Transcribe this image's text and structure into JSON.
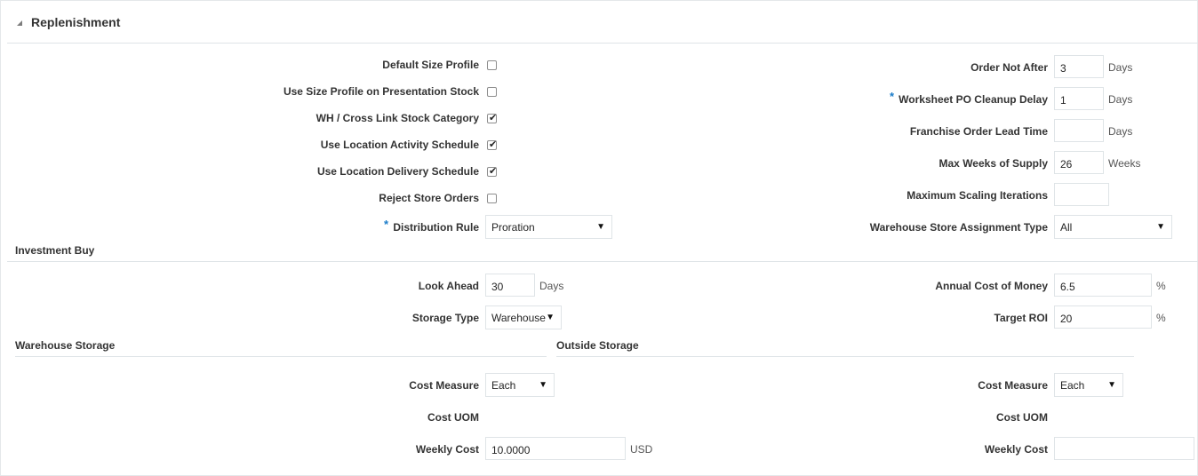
{
  "header": {
    "title": "Replenishment"
  },
  "left": {
    "default_size_profile": {
      "label": "Default Size Profile",
      "checked": false
    },
    "use_size_profile": {
      "label": "Use Size Profile on Presentation Stock",
      "checked": false
    },
    "wh_cross_link": {
      "label": "WH / Cross Link Stock Category",
      "checked": true
    },
    "use_activity_schedule": {
      "label": "Use Location Activity Schedule",
      "checked": true
    },
    "use_delivery_schedule": {
      "label": "Use Location Delivery Schedule",
      "checked": true
    },
    "reject_store_orders": {
      "label": "Reject Store Orders",
      "checked": false
    },
    "distribution_rule": {
      "label": "Distribution Rule",
      "value": "Proration"
    }
  },
  "right": {
    "order_not_after": {
      "label": "Order Not After",
      "value": "3",
      "unit": "Days"
    },
    "worksheet_po_cleanup": {
      "label": "Worksheet PO Cleanup Delay",
      "value": "1",
      "unit": "Days"
    },
    "franchise_lead_time": {
      "label": "Franchise Order Lead Time",
      "value": "",
      "unit": "Days"
    },
    "max_weeks_supply": {
      "label": "Max Weeks of Supply",
      "value": "26",
      "unit": "Weeks"
    },
    "max_scaling_iterations": {
      "label": "Maximum Scaling Iterations",
      "value": ""
    },
    "warehouse_store_assignment": {
      "label": "Warehouse Store Assignment Type",
      "value": "All"
    }
  },
  "investment_buy": {
    "title": "Investment Buy",
    "look_ahead": {
      "label": "Look Ahead",
      "value": "30",
      "unit": "Days"
    },
    "storage_type": {
      "label": "Storage Type",
      "value": "Warehouse"
    },
    "annual_cost_of_money": {
      "label": "Annual Cost of Money",
      "value": "6.5",
      "unit": "%"
    },
    "target_roi": {
      "label": "Target ROI",
      "value": "20",
      "unit": "%"
    }
  },
  "warehouse_storage": {
    "title": "Warehouse Storage",
    "cost_measure": {
      "label": "Cost Measure",
      "value": "Each"
    },
    "cost_uom": {
      "label": "Cost UOM"
    },
    "weekly_cost": {
      "label": "Weekly Cost",
      "value": "10.0000",
      "unit": "USD"
    }
  },
  "outside_storage": {
    "title": "Outside Storage",
    "cost_measure": {
      "label": "Cost Measure",
      "value": "Each"
    },
    "cost_uom": {
      "label": "Cost UOM"
    },
    "weekly_cost": {
      "label": "Weekly Cost",
      "value": ""
    }
  },
  "glyphs": {
    "check": "✔",
    "arrow": "▼",
    "required": "*"
  },
  "colors": {
    "required": "#1a7cc9",
    "border": "#dfe4e7"
  },
  "icons": {
    "collapse": "collapse-triangle-icon",
    "dropdown": "chevron-down-icon"
  }
}
